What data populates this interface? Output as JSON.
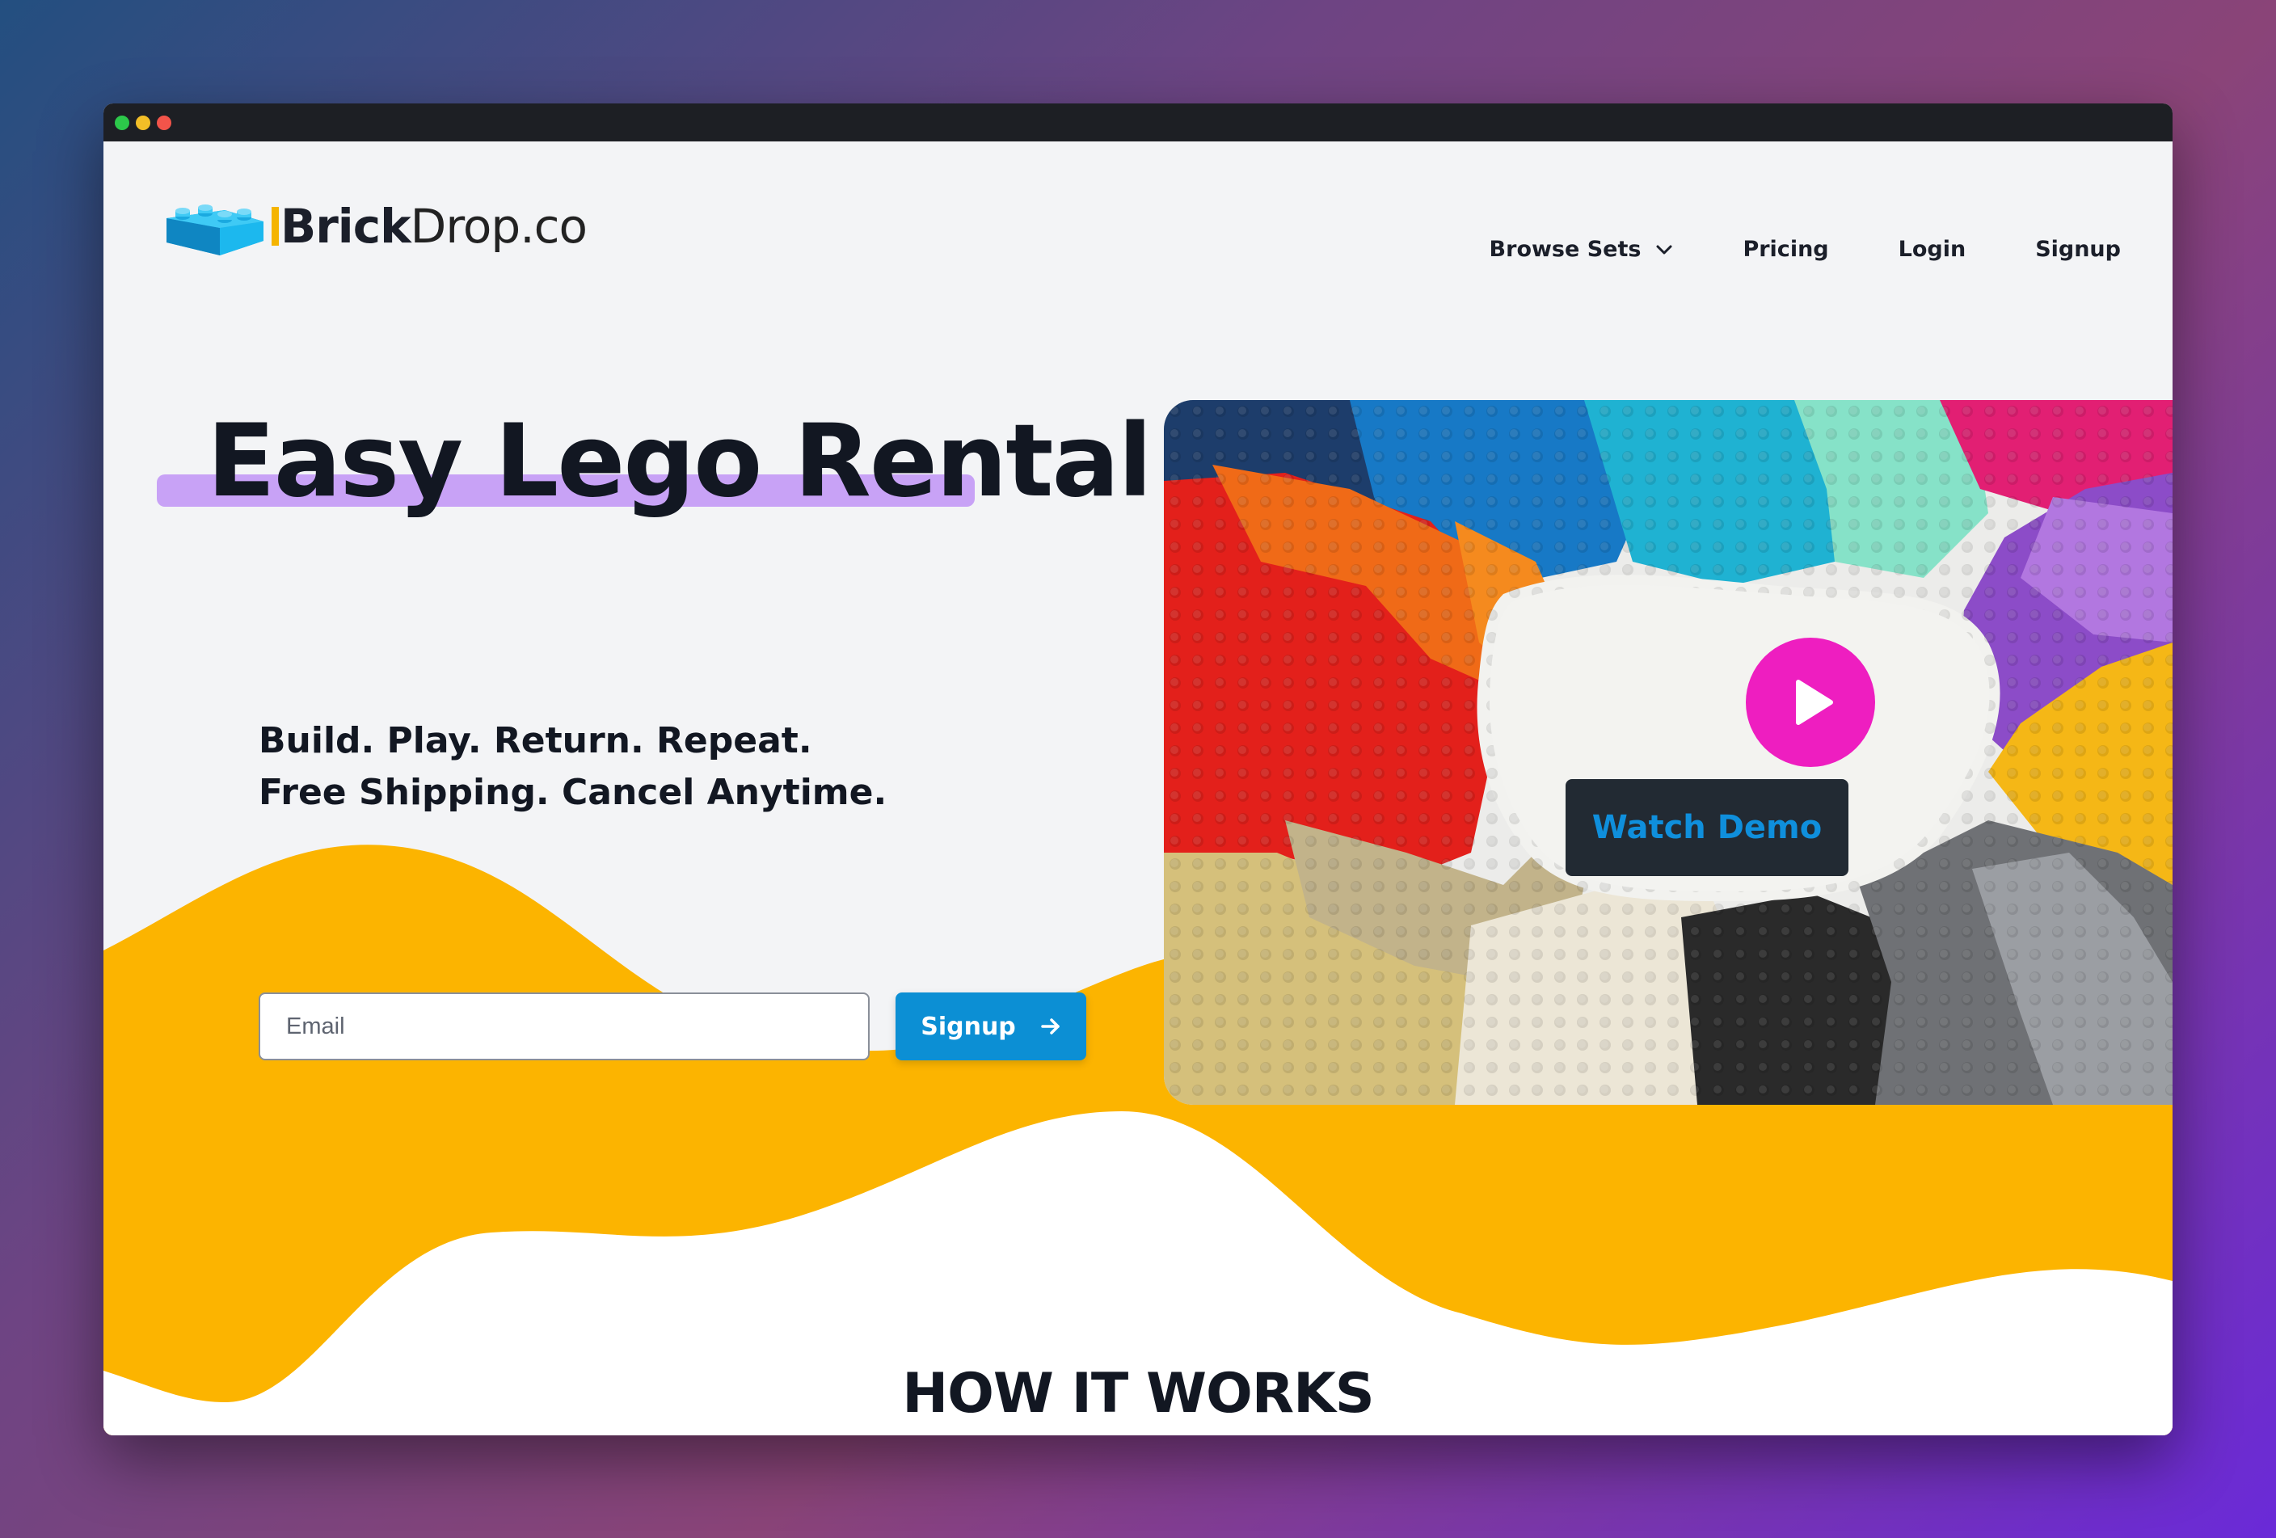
{
  "window": {
    "traffic_lights": [
      "green",
      "yellow",
      "red"
    ]
  },
  "brand": {
    "name_bold": "Brick",
    "name_regular": "Drop.co",
    "logo_icon": "lego-brick-icon"
  },
  "nav": {
    "items": [
      {
        "label": "Browse Sets",
        "has_dropdown": true
      },
      {
        "label": "Pricing"
      },
      {
        "label": "Login"
      },
      {
        "label": "Signup"
      }
    ]
  },
  "hero": {
    "title": "Easy Lego Rental",
    "tagline_line1": "Build. Play. Return. Repeat.",
    "tagline_line2": "Free Shipping. Cancel Anytime.",
    "email_placeholder": "Email",
    "signup_label": "Signup"
  },
  "video": {
    "play_icon": "play-icon",
    "watch_label": "Watch Demo"
  },
  "how_it_works": {
    "title": "HOW IT WORKS",
    "step_icon_colors": [
      "#f01ec6",
      "#13b0d6",
      "#9b3cf0"
    ]
  },
  "chat": {
    "icon": "chat-bubble-icon"
  },
  "colors": {
    "accent_yellow": "#fcb400",
    "primary_blue": "#0c8fd4",
    "highlight_purple": "#c8a2f6",
    "play_pink": "#ee1ec0",
    "text_dark": "#121722"
  }
}
